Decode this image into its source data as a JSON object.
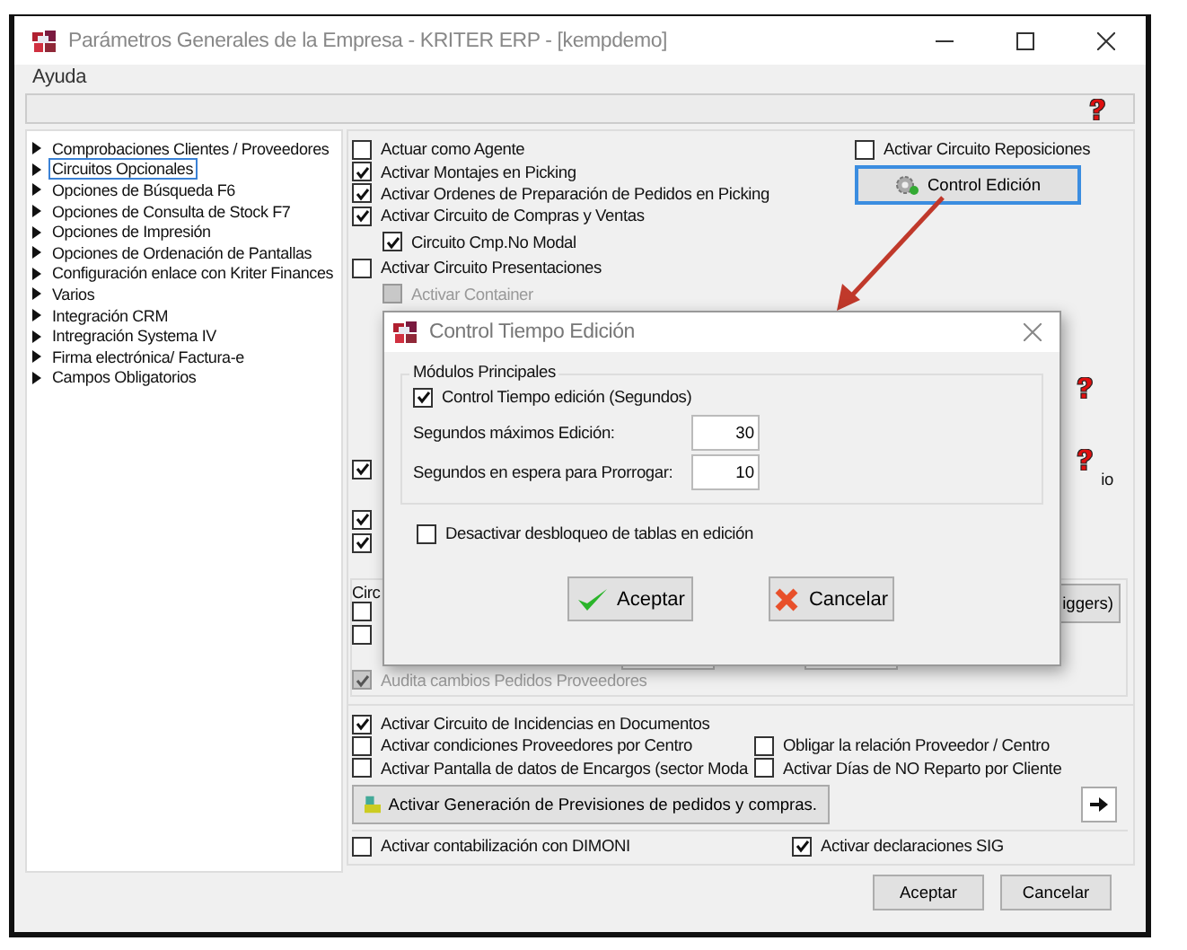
{
  "window": {
    "title": "Parámetros Generales de la Empresa - KRITER ERP - [kempdemo]",
    "menu": [
      "Ayuda"
    ]
  },
  "tree": [
    {
      "label": "Comprobaciones Clientes / Proveedores",
      "selected": false
    },
    {
      "label": "Circuitos Opcionales",
      "selected": true
    },
    {
      "label": "Opciones de Búsqueda F6",
      "selected": false
    },
    {
      "label": "Opciones de Consulta de Stock F7",
      "selected": false
    },
    {
      "label": "Opciones de Impresión",
      "selected": false
    },
    {
      "label": "Opciones de Ordenación de Pantallas",
      "selected": false
    },
    {
      "label": "Configuración enlace con Kriter Finances",
      "selected": false
    },
    {
      "label": "Varios",
      "selected": false
    },
    {
      "label": "Integración CRM",
      "selected": false
    },
    {
      "label": "Intregración Systema IV",
      "selected": false
    },
    {
      "label": "Firma electrónica/ Factura-e",
      "selected": false
    },
    {
      "label": "Campos Obligatorios",
      "selected": false
    }
  ],
  "options": [
    {
      "label": "Actuar como Agente",
      "checked": false,
      "disabled": false
    },
    {
      "label": "Activar Montajes en Picking",
      "checked": true,
      "disabled": false
    },
    {
      "label": "Activar Ordenes de Preparación de Pedidos en Picking",
      "checked": true,
      "disabled": false
    },
    {
      "label": "Activar Circuito de Compras y Ventas",
      "checked": true,
      "disabled": false,
      "children": [
        {
          "label": "Circuito Cmp.No Modal",
          "checked": true,
          "disabled": false
        }
      ]
    },
    {
      "label": "Activar Circuito Presentaciones",
      "checked": false,
      "disabled": false,
      "children": [
        {
          "label": "Activar Container",
          "checked": false,
          "disabled": true
        }
      ]
    }
  ],
  "side": {
    "checkbox": {
      "label": "Activar Circuito Reposiciones",
      "checked": false
    },
    "button": "Control Edición"
  },
  "covered": {
    "checks": [
      {
        "checked": true
      },
      {
        "checked": true
      },
      {
        "checked": true
      }
    ],
    "fragment": "io"
  },
  "group": {
    "label": "Circ",
    "checks": [
      {
        "checked": false
      },
      {
        "checked": false
      }
    ],
    "button": "iggers)",
    "audit": {
      "label": "Audita cambios Pedidos Proveedores",
      "checked": true,
      "disabled": true
    }
  },
  "lower": [
    {
      "label": "Activar Circuito de Incidencias en Documentos",
      "checked": true
    },
    {
      "label": "Activar condiciones Proveedores por Centro",
      "checked": false
    },
    {
      "label": "Obligar la relación Proveedor / Centro",
      "checked": false
    },
    {
      "label": "Activar Pantalla de datos de Encargos (sector Moda",
      "checked": false
    },
    {
      "label": "Activar Días de NO Reparto por Cliente",
      "checked": false
    }
  ],
  "generate_button": "Activar Generación de Previsiones de pedidos y compras.",
  "last": [
    {
      "label": "Activar contabilización con DIMONI",
      "checked": false
    },
    {
      "label": "Activar declaraciones SIG",
      "checked": true
    }
  ],
  "footer": [
    "Aceptar",
    "Cancelar"
  ],
  "dialog": {
    "title": "Control Tiempo Edición",
    "group": "Módulos Principales",
    "check": {
      "label": "Control Tiempo edición (Segundos)",
      "checked": true
    },
    "fields": [
      {
        "label": "Segundos máximos Edición:",
        "value": "30"
      },
      {
        "label": "Segundos en espera para Prorrogar:",
        "value": "10"
      }
    ],
    "check2": {
      "label": "Desactivar desbloqueo de tablas en edición",
      "checked": false
    },
    "buttons": [
      {
        "label": "Aceptar",
        "kind": "accept"
      },
      {
        "label": "Cancelar",
        "kind": "cancel"
      }
    ]
  }
}
